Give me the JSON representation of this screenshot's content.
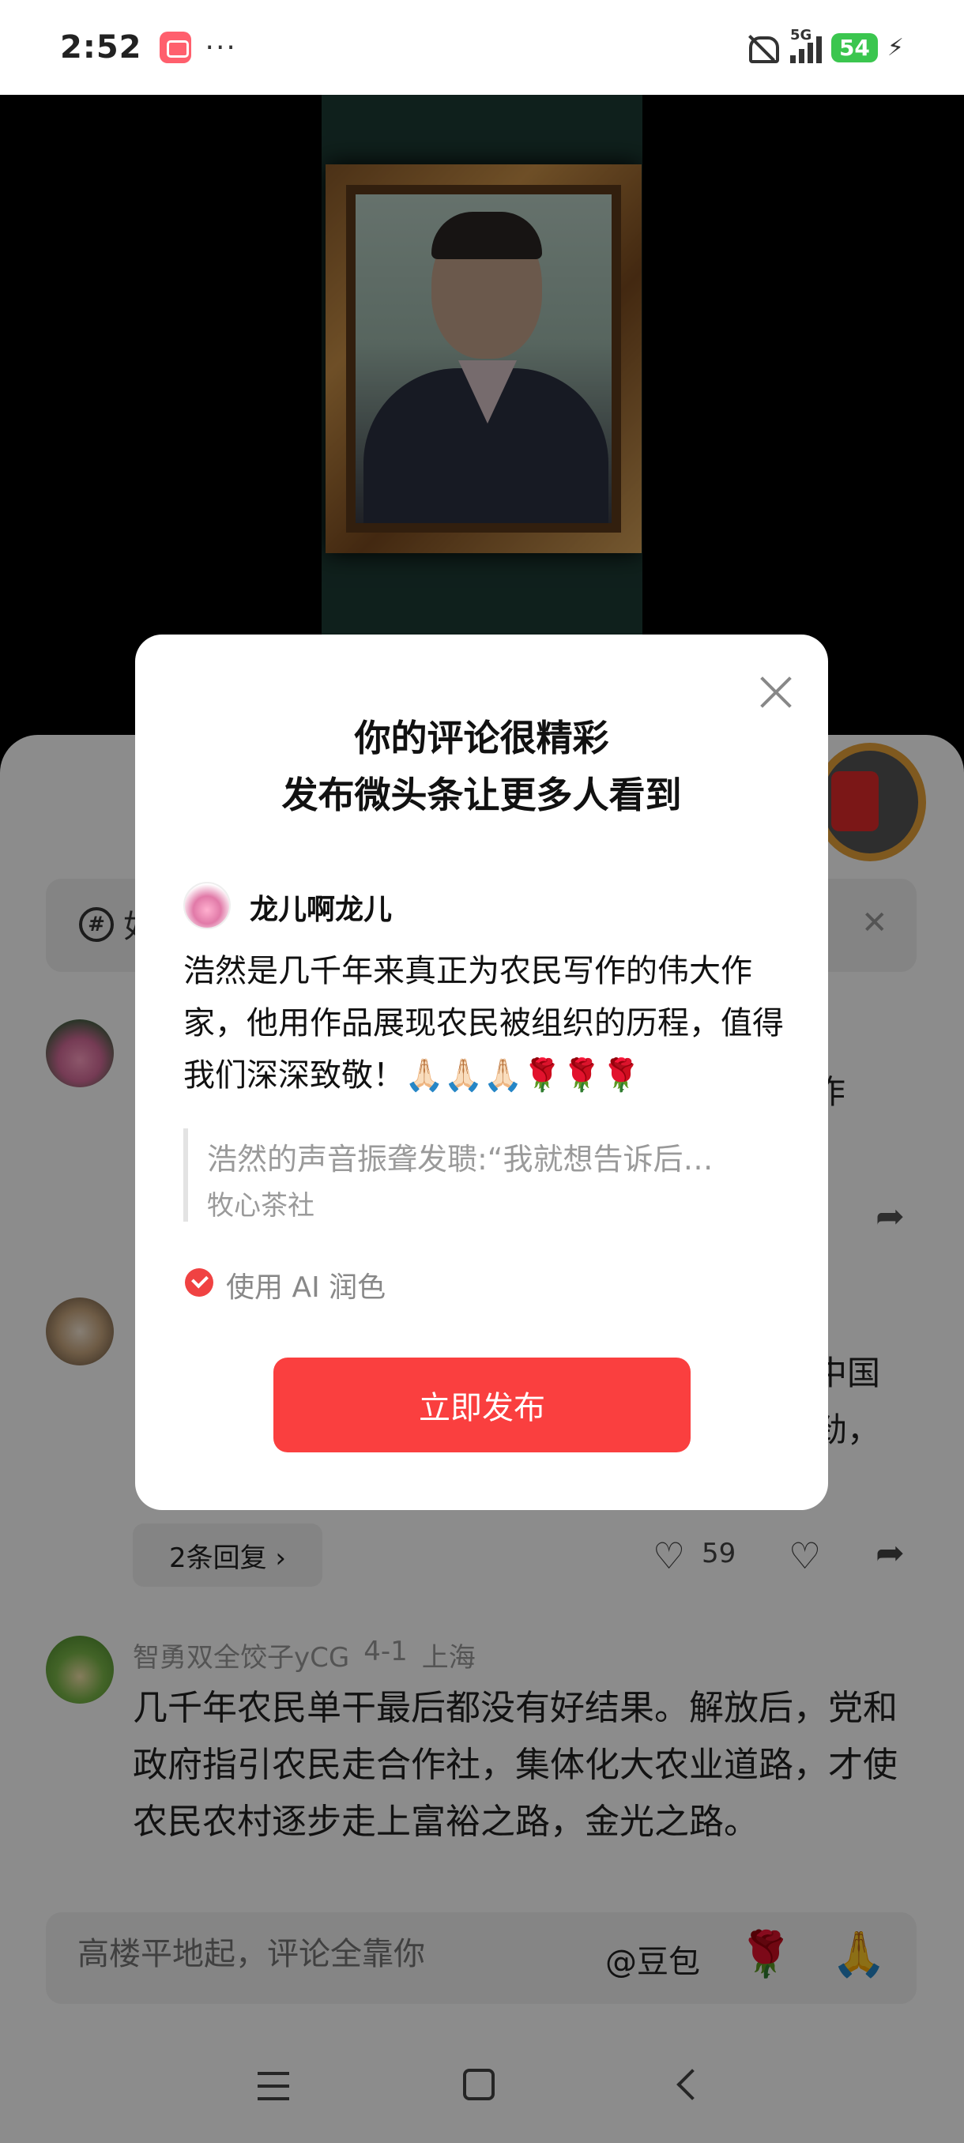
{
  "status_bar": {
    "time": "2:52",
    "more": "···",
    "network": "5G",
    "battery": "54",
    "charging_icon": "⚡"
  },
  "background": {
    "topic_char": "如",
    "comment2_frag1": "中国",
    "comment2_frag2": "劲，",
    "comment1_frag": "作",
    "reply_label": "2条回复 ›",
    "like_count": "59",
    "comment3": {
      "user": "智勇双全饺子yCG",
      "date": "4-1",
      "location": "上海",
      "text": "几千年农民单干最后都没有好结果。解放后，党和政府指引农民走合作社，集体化大农业道路，才使农民农村逐步走上富裕之路，金光之路。"
    },
    "input_placeholder": "高楼平地起，评论全靠你",
    "at_label": "@豆包",
    "emoji_rose": "🌹",
    "emoji_pray": "🙏"
  },
  "dialog": {
    "title_line1": "你的评论很精彩",
    "title_line2": "发布微头条让更多人看到",
    "username": "龙儿啊龙儿",
    "comment": "浩然是几千年来真正为农民写作的伟大作家，他用作品展现农民被组织的历程，值得我们深深致敬！🙏🏻🙏🏻🙏🏻🌹🌹🌹",
    "quote": "浩然的声音振聋发聩:“我就想告诉后…",
    "quote_source": "牧心茶社",
    "ai_option": "使用 AI 润色",
    "publish_button": "立即发布"
  },
  "colors": {
    "accent": "#fa3f3f",
    "battery": "#3bc64f"
  }
}
